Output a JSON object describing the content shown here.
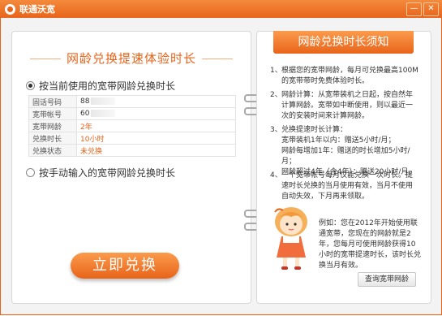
{
  "window": {
    "title": "联通沃宽",
    "minimize": "—",
    "close": "✕"
  },
  "left": {
    "title": "网龄兑换提速体验时长",
    "option_current": "按当前使用的宽带网龄兑换时长",
    "option_manual": "按手动输入的宽带网龄兑换时长",
    "rows": [
      {
        "key": "固话号码",
        "value": "88"
      },
      {
        "key": "宽带帐号",
        "value": "60"
      },
      {
        "key": "宽带网龄",
        "value": "2年"
      },
      {
        "key": "兑换时长",
        "value": "10小时"
      },
      {
        "key": "兑换状态",
        "value": "未兑换"
      }
    ],
    "button": "立即兑换"
  },
  "right": {
    "title": "网龄兑换时长须知",
    "rules": [
      {
        "n": "1、",
        "lines": [
          "根据您的宽带网龄，每月可兑换最高100M的宽带带时免费体验时长。"
        ]
      },
      {
        "n": "2、",
        "lines": [
          "网龄计算：从宽带装机之日起，按自然年计算网龄。宽带如中断使用，则以最近一次的安装时间来计算网龄。"
        ]
      },
      {
        "n": "3、",
        "lines": [
          "兑换提速时长计算：",
          "宽带装机1年以内：赠送5小时/月；",
          "网龄每增加1年：赠送的时长增加5小时/月；",
          "网龄超过4年（含4年）：赠送20小时/月。"
        ]
      },
      {
        "n": "4、",
        "lines": [
          "一个宽带帐号每月仅能兑换一次时长。提速时长兑换的当月使用有效，当月不使用自动失效，下月再来领取。"
        ]
      }
    ],
    "example": "例如：您在2012年开始使用联通宽带，您现在的网龄就是2年，您每月可使用网龄获得10小时的宽带提速时长，该时长兑换当月有效。",
    "query_button": "查询宽带网龄"
  }
}
